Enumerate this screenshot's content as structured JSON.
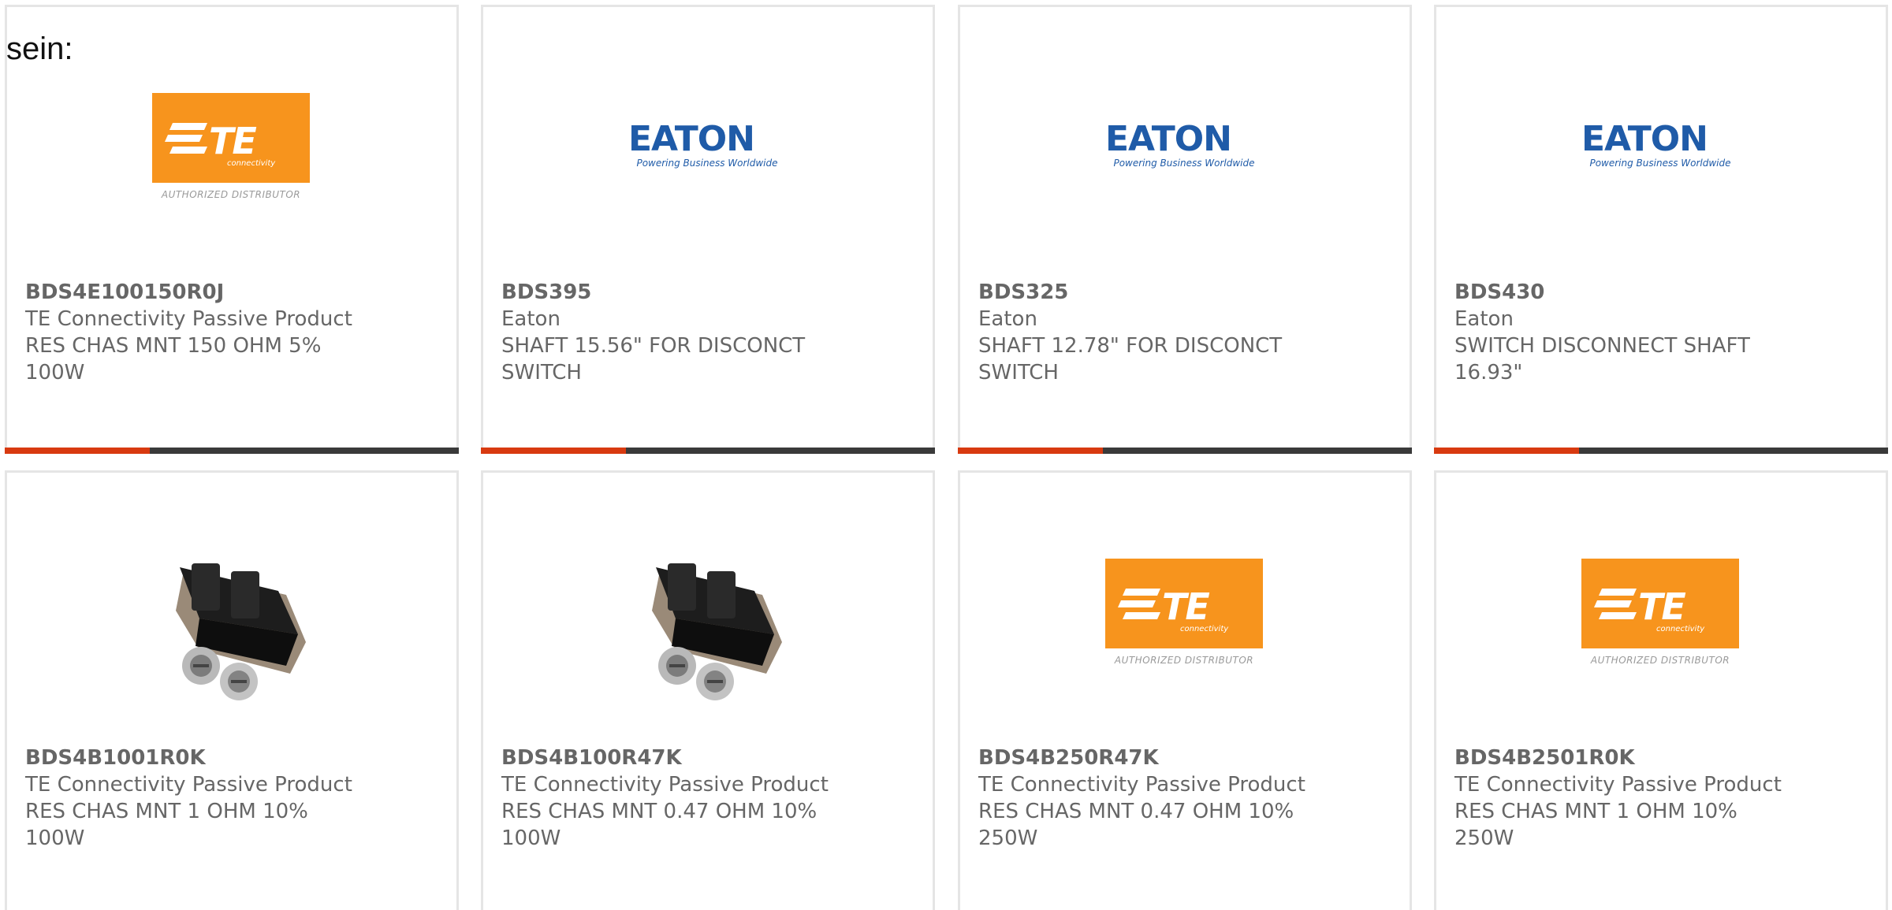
{
  "intro_text": "sein:",
  "logos": {
    "te_subtitle": "AUTHORIZED DISTRIBUTOR",
    "te_word": "TE",
    "te_tagline": "connectivity",
    "eaton_word": "EATON",
    "eaton_tagline": "Powering Business Worldwide"
  },
  "colors": {
    "te_orange": "#f7941d",
    "eaton_blue": "#1f5ba8",
    "accent_bar": "#d83a10",
    "bar_dark": "#3a3a3a",
    "text_gray": "#666666"
  },
  "products": [
    {
      "part_number": "BDS4E100150R0J",
      "manufacturer": "TE Connectivity Passive Product",
      "description": "RES CHAS MNT 150 OHM 5% 100W",
      "image": "te-logo"
    },
    {
      "part_number": "BDS395",
      "manufacturer": "Eaton",
      "description": "SHAFT 15.56\" FOR DISCONCT SWITCH",
      "image": "eaton-logo"
    },
    {
      "part_number": "BDS325",
      "manufacturer": "Eaton",
      "description": "SHAFT 12.78\" FOR DISCONCT SWITCH",
      "image": "eaton-logo"
    },
    {
      "part_number": "BDS430",
      "manufacturer": "Eaton",
      "description": "SWITCH DISCONNECT SHAFT 16.93\"",
      "image": "eaton-logo"
    },
    {
      "part_number": "BDS4B1001R0K",
      "manufacturer": "TE Connectivity Passive Product",
      "description": "RES CHAS MNT 1 OHM 10% 100W",
      "image": "resistor-photo"
    },
    {
      "part_number": "BDS4B100R47K",
      "manufacturer": "TE Connectivity Passive Product",
      "description": "RES CHAS MNT 0.47 OHM 10% 100W",
      "image": "resistor-photo"
    },
    {
      "part_number": "BDS4B250R47K",
      "manufacturer": "TE Connectivity Passive Product",
      "description": "RES CHAS MNT 0.47 OHM 10% 250W",
      "image": "te-logo"
    },
    {
      "part_number": "BDS4B2501R0K",
      "manufacturer": "TE Connectivity Passive Product",
      "description": "RES CHAS MNT 1 OHM 10% 250W",
      "image": "te-logo"
    }
  ]
}
